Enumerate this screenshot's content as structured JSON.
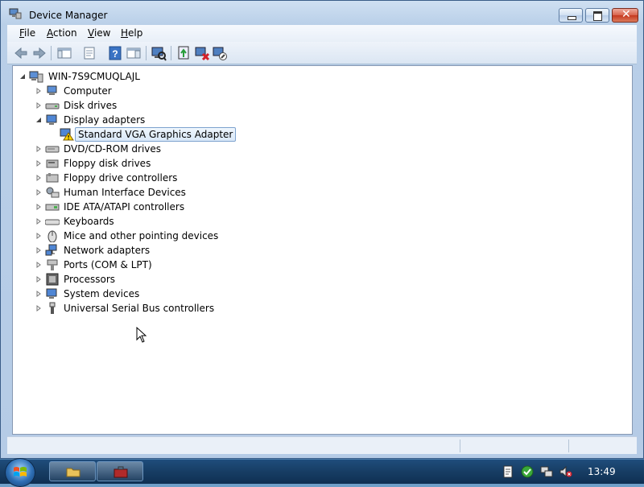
{
  "window": {
    "title": "Device Manager",
    "controls": {
      "minimize": "minimize",
      "maximize": "maximize",
      "close": "close"
    }
  },
  "menu": [
    "File",
    "Action",
    "View",
    "Help"
  ],
  "toolbar": {
    "icons": [
      "back-arrow-icon",
      "forward-arrow-icon",
      "show-hide-console-tree-icon",
      "properties-icon",
      "help-icon",
      "show-hide-action-pane-icon",
      "scan-hardware-icon",
      "update-driver-icon",
      "uninstall-icon",
      "disable-icon"
    ]
  },
  "tree": {
    "root": "WIN-7S9CMUQLAJL",
    "items": [
      {
        "label": "Computer",
        "expanded": false
      },
      {
        "label": "Disk drives",
        "expanded": false
      },
      {
        "label": "Display adapters",
        "expanded": true,
        "children": [
          {
            "label": "Standard VGA Graphics Adapter",
            "selected": true,
            "warning": true
          }
        ]
      },
      {
        "label": "DVD/CD-ROM drives",
        "expanded": false
      },
      {
        "label": "Floppy disk drives",
        "expanded": false
      },
      {
        "label": "Floppy drive controllers",
        "expanded": false
      },
      {
        "label": "Human Interface Devices",
        "expanded": false
      },
      {
        "label": "IDE ATA/ATAPI controllers",
        "expanded": false
      },
      {
        "label": "Keyboards",
        "expanded": false
      },
      {
        "label": "Mice and other pointing devices",
        "expanded": false
      },
      {
        "label": "Network adapters",
        "expanded": false
      },
      {
        "label": "Ports (COM & LPT)",
        "expanded": false
      },
      {
        "label": "Processors",
        "expanded": false
      },
      {
        "label": "System devices",
        "expanded": false
      },
      {
        "label": "Universal Serial Bus controllers",
        "expanded": false
      }
    ]
  },
  "taskbar": {
    "clock": "13:49",
    "tray_icons": [
      "action-center-icon",
      "security-check-icon",
      "network-icon",
      "volume-muted-icon"
    ]
  },
  "colors": {
    "selection": "#d9e8f8",
    "taskbar": "#1f4d7c",
    "close_button": "#c5381f"
  }
}
